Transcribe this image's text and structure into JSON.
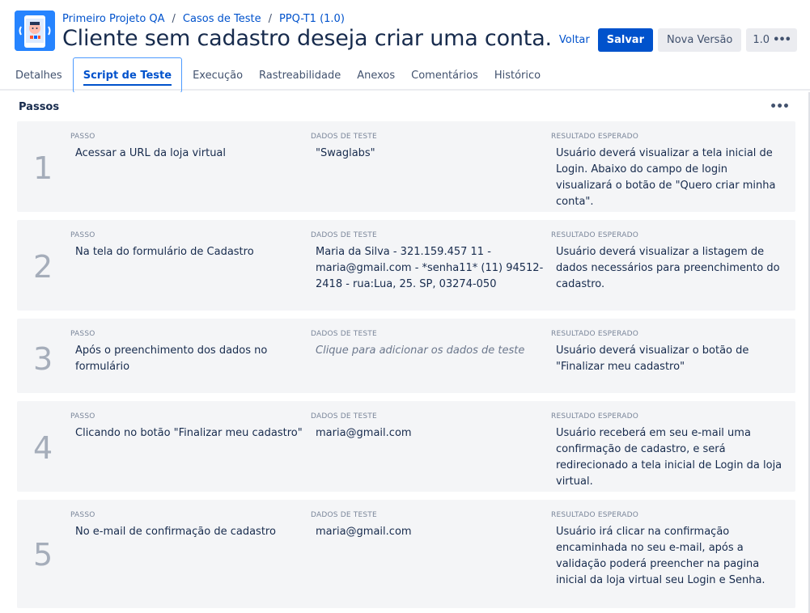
{
  "breadcrumb": {
    "project": "Primeiro Projeto QA",
    "section": "Casos de Teste",
    "key": "PPQ-T1 (1.0)"
  },
  "title": "Cliente sem cadastro deseja criar uma conta.",
  "actions": {
    "back": "Voltar",
    "save": "Salvar",
    "new_version": "Nova Versão",
    "version": "1.0"
  },
  "tabs": [
    {
      "label": "Detalhes"
    },
    {
      "label": "Script de Teste"
    },
    {
      "label": "Execução"
    },
    {
      "label": "Rastreabilidade"
    },
    {
      "label": "Anexos"
    },
    {
      "label": "Comentários"
    },
    {
      "label": "Histórico"
    }
  ],
  "steps_section": {
    "title": "Passos",
    "col_step": "PASSO",
    "col_data": "DADOS DE TESTE",
    "col_result": "RESULTADO ESPERADO"
  },
  "steps": [
    {
      "number": "1",
      "step": "Acessar a URL da loja virtual",
      "data": "\"Swaglabs\"",
      "result": "Usuário deverá visualizar a tela inicial de Login. Abaixo do campo de login visualizará o botão de \"Quero criar minha conta\"."
    },
    {
      "number": "2",
      "step": "Na tela do formulário de Cadastro",
      "data": "Maria da Silva - 321.159.457 11 - maria@gmail.com - *senha11* (11) 94512-2418 - rua:Lua, 25. SP, 03274-050",
      "result": "Usuário deverá visualizar a listagem de dados necessários para preenchimento do cadastro."
    },
    {
      "number": "3",
      "step": "Após o preenchimento dos dados no formulário",
      "data": "Clique para adicionar os dados de teste",
      "result": "Usuário deverá visualizar o botão de \"Finalizar meu cadastro\""
    },
    {
      "number": "4",
      "step": "Clicando no botão \"Finalizar meu cadastro\"",
      "data": "maria@gmail.com",
      "result": "Usuário receberá em seu e-mail uma confirmação de cadastro, e será redirecionado a tela inicial de Login da loja virtual."
    },
    {
      "number": "5",
      "step": "No e-mail de confirmação de cadastro",
      "data": "maria@gmail.com",
      "result": "Usuário irá clicar na confirmação encaminhada no seu e-mail, após a validação poderá preencher na pagina inicial da loja virtual seu Login e Senha."
    }
  ],
  "colors": {
    "accent": "#0052cc",
    "logo_bg": "#2684ff",
    "card_bg": "#f4f5f7"
  },
  "icons": {
    "logo": "qa-app-logo",
    "more": "more-horizontal-icon",
    "version_more": "more-horizontal-icon"
  }
}
